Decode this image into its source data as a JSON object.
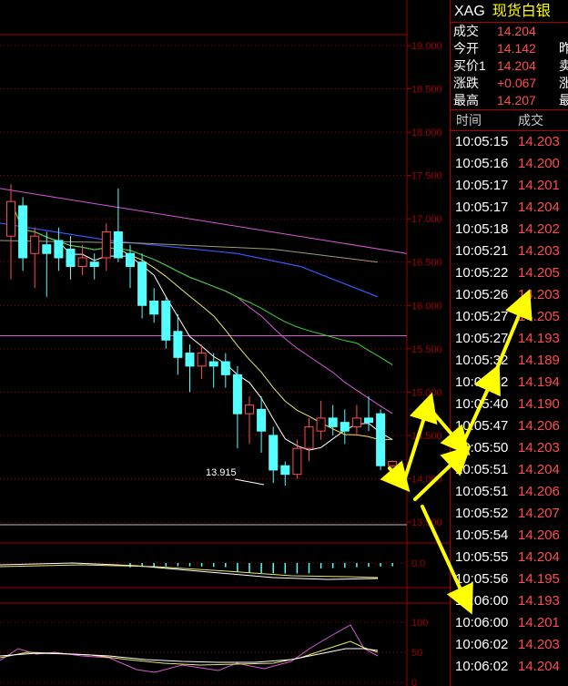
{
  "header": {
    "symbol": "XAG",
    "name": "现货白银"
  },
  "quote": [
    {
      "label": "成交",
      "value": "14.204",
      "trail": ""
    },
    {
      "label": "今开",
      "value": "14.142",
      "trail": "昨"
    },
    {
      "label": "买价1",
      "value": "14.204",
      "trail": "卖"
    },
    {
      "label": "涨跌",
      "value": "+0.067",
      "trail": "涨"
    },
    {
      "label": "最高",
      "value": "14.207",
      "trail": "最"
    }
  ],
  "ticks_header": {
    "time": "时间",
    "price": "成交"
  },
  "ticks": [
    {
      "time": "10:05:15",
      "price": "14.203"
    },
    {
      "time": "10:05:16",
      "price": "14.200"
    },
    {
      "time": "10:05:17",
      "price": "14.201"
    },
    {
      "time": "10:05:17",
      "price": "14.204"
    },
    {
      "time": "10:05:18",
      "price": "14.202"
    },
    {
      "time": "10:05:21",
      "price": "14.203"
    },
    {
      "time": "10:05:22",
      "price": "14.205"
    },
    {
      "time": "10:05:26",
      "price": "14.203"
    },
    {
      "time": "10:05:27",
      "price": "14.205"
    },
    {
      "time": "10:05:27",
      "price": "14.193"
    },
    {
      "time": "10:05:32",
      "price": "14.189"
    },
    {
      "time": "10:05:32",
      "price": "14.194"
    },
    {
      "time": "10:05:40",
      "price": "14.190"
    },
    {
      "time": "10:05:47",
      "price": "14.206"
    },
    {
      "time": "10:05:50",
      "price": "14.203"
    },
    {
      "time": "10:05:51",
      "price": "14.204"
    },
    {
      "time": "10:05:51",
      "price": "14.206"
    },
    {
      "time": "10:05:52",
      "price": "14.207"
    },
    {
      "time": "10:05:54",
      "price": "14.206"
    },
    {
      "time": "10:05:55",
      "price": "14.204"
    },
    {
      "time": "10:05:56",
      "price": "14.195"
    },
    {
      "time": "10:06:00",
      "price": "14.193"
    },
    {
      "time": "10:06:00",
      "price": "14.201"
    },
    {
      "time": "10:06:02",
      "price": "14.203"
    },
    {
      "time": "10:06:02",
      "price": "14.204"
    }
  ],
  "chart_data": {
    "type": "candlestick",
    "price_axis": [
      "19.000",
      "18.500",
      "18.000",
      "17.500",
      "17.000",
      "16.500",
      "16.000",
      "15.500",
      "15.000",
      "14.500",
      "14.000",
      "13.500"
    ],
    "ylim": [
      13.5,
      19.2
    ],
    "low_annotation": "13.915",
    "candles": [
      {
        "o": 16.8,
        "c": 17.2,
        "h": 17.4,
        "l": 16.3
      },
      {
        "o": 17.15,
        "c": 16.55,
        "h": 17.25,
        "l": 16.4
      },
      {
        "o": 16.6,
        "c": 16.8,
        "h": 16.9,
        "l": 16.2
      },
      {
        "o": 16.7,
        "c": 16.6,
        "h": 16.85,
        "l": 16.1
      },
      {
        "o": 16.75,
        "c": 16.55,
        "h": 16.9,
        "l": 16.4
      },
      {
        "o": 16.65,
        "c": 16.45,
        "h": 16.8,
        "l": 16.3
      },
      {
        "o": 16.45,
        "c": 16.55,
        "h": 16.7,
        "l": 16.35
      },
      {
        "o": 16.5,
        "c": 16.45,
        "h": 16.6,
        "l": 16.3
      },
      {
        "o": 16.55,
        "c": 16.85,
        "h": 16.95,
        "l": 16.4
      },
      {
        "o": 16.85,
        "c": 16.55,
        "h": 17.35,
        "l": 16.5
      },
      {
        "o": 16.6,
        "c": 16.45,
        "h": 16.7,
        "l": 16.2
      },
      {
        "o": 16.5,
        "c": 16.0,
        "h": 16.6,
        "l": 15.85
      },
      {
        "o": 16.05,
        "c": 15.9,
        "h": 16.2,
        "l": 15.8
      },
      {
        "o": 16.05,
        "c": 15.6,
        "h": 16.1,
        "l": 15.5
      },
      {
        "o": 15.7,
        "c": 15.4,
        "h": 15.9,
        "l": 15.2
      },
      {
        "o": 15.45,
        "c": 15.3,
        "h": 15.55,
        "l": 15.0
      },
      {
        "o": 15.3,
        "c": 15.45,
        "h": 15.55,
        "l": 15.15
      },
      {
        "o": 15.35,
        "c": 15.3,
        "h": 15.45,
        "l": 15.05
      },
      {
        "o": 15.35,
        "c": 15.2,
        "h": 15.45,
        "l": 15.05
      },
      {
        "o": 15.2,
        "c": 14.75,
        "h": 15.3,
        "l": 14.35
      },
      {
        "o": 14.75,
        "c": 14.85,
        "h": 14.95,
        "l": 14.4
      },
      {
        "o": 14.8,
        "c": 14.55,
        "h": 14.95,
        "l": 14.3
      },
      {
        "o": 14.5,
        "c": 14.1,
        "h": 14.6,
        "l": 13.95
      },
      {
        "o": 14.15,
        "c": 14.05,
        "h": 14.2,
        "l": 13.92
      },
      {
        "o": 14.05,
        "c": 14.35,
        "h": 14.45,
        "l": 14.0
      },
      {
        "o": 14.35,
        "c": 14.6,
        "h": 14.7,
        "l": 14.2
      },
      {
        "o": 14.55,
        "c": 14.7,
        "h": 14.9,
        "l": 14.45
      },
      {
        "o": 14.7,
        "c": 14.6,
        "h": 14.85,
        "l": 14.5
      },
      {
        "o": 14.65,
        "c": 14.55,
        "h": 14.8,
        "l": 14.4
      },
      {
        "o": 14.6,
        "c": 14.7,
        "h": 14.85,
        "l": 14.5
      },
      {
        "o": 14.7,
        "c": 14.65,
        "h": 14.95,
        "l": 14.55
      },
      {
        "o": 14.75,
        "c": 14.15,
        "h": 14.8,
        "l": 14.1
      },
      {
        "o": 14.15,
        "c": 14.2,
        "h": 14.21,
        "l": 14.13
      }
    ],
    "macd_axis": [
      "0.0"
    ],
    "kdj_axis": [
      "100",
      "50",
      "0"
    ],
    "colors": {
      "up": "#ff4d4d",
      "down": "#54ffff",
      "grid": "#a00000",
      "ma_purple": "#d65ad6",
      "ma_blue": "#3a56ff",
      "ma_green": "#3ad23a",
      "ma_yellow": "#e8e86a",
      "ma_white": "#ffffff",
      "ma_gray": "#9c9c7c",
      "arrow": "#ffff00"
    }
  }
}
